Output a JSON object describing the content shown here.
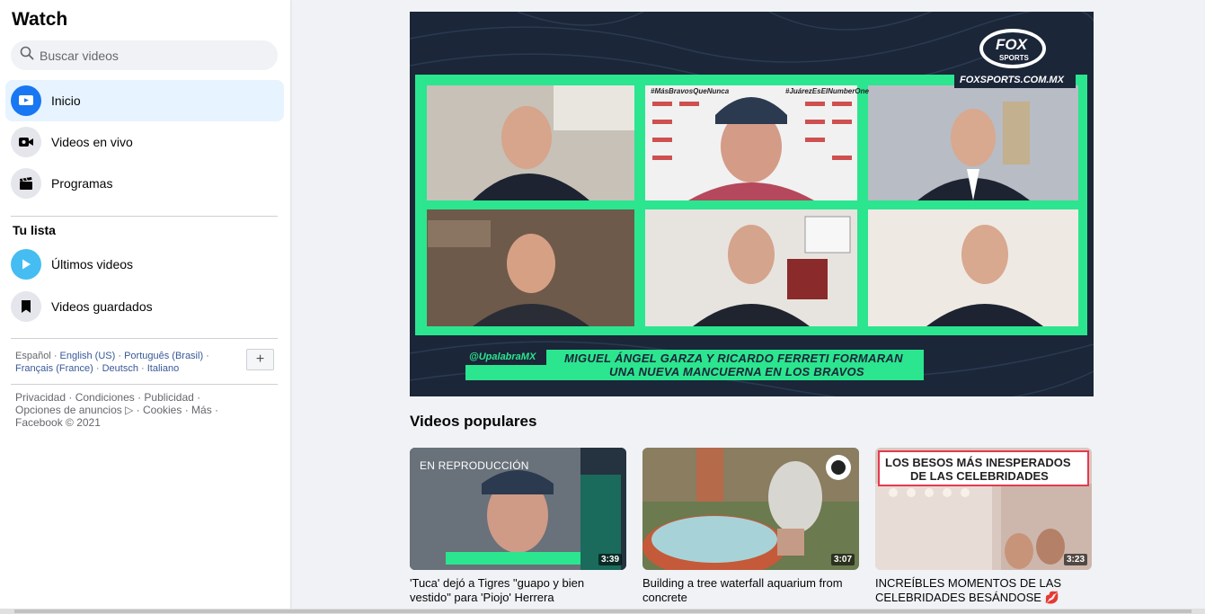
{
  "sidebar": {
    "title": "Watch",
    "search_placeholder": "Buscar videos",
    "items": [
      {
        "label": "Inicio",
        "icon": "video-screen-icon"
      },
      {
        "label": "Videos en vivo",
        "icon": "live-camera-icon"
      },
      {
        "label": "Programas",
        "icon": "clapperboard-icon"
      }
    ],
    "list_title": "Tu lista",
    "list_items": [
      {
        "label": "Últimos videos",
        "icon": "play-icon"
      },
      {
        "label": "Videos guardados",
        "icon": "bookmark-icon"
      }
    ],
    "languages": {
      "current": "Español",
      "others": [
        "English (US)",
        "Português (Brasil)",
        "Français (France)",
        "Deutsch",
        "Italiano"
      ],
      "more_label": "+"
    },
    "footer": {
      "privacy": "Privacidad",
      "terms": "Condiciones",
      "advertising": "Publicidad",
      "ad_choices": "Opciones de anuncios",
      "cookies": "Cookies",
      "more": "Más",
      "copyright": "Facebook © 2021"
    }
  },
  "video": {
    "brand": "FOXSPORTS.COM.MX",
    "logo_text_top": "FOX",
    "logo_text_bottom": "SPORTS",
    "handle": "@UpalabraMX",
    "headline_line1": "MIGUEL ÁNGEL GARZA Y RICARDO FERRETI FORMARAN",
    "headline_line2": "UNA NUEVA MANCUERNA EN LOS BRAVOS",
    "hashtag_left": "#MásBravosQueNunca",
    "hashtag_right": "#JuárezEsElNumberOne"
  },
  "popular": {
    "heading": "Videos populares",
    "cards": [
      {
        "title": "'Tuca' dejó a Tigres \"guapo y bien vestido\" para 'Piojo' Herrera",
        "duration": "3:39",
        "overlay": "EN REPRODUCCIÓN"
      },
      {
        "title": "Building a tree waterfall aquarium from concrete",
        "duration": "3:07"
      },
      {
        "title": "INCREÍBLES MOMENTOS DE LAS CELEBRIDADES BESÁNDOSE 💋",
        "duration": "3:23",
        "banner_line1": "LOS BESOS MÁS INESPERADOS",
        "banner_line2": "DE LAS CELEBRIDADES"
      }
    ]
  },
  "colors": {
    "accent": "#1877f2",
    "video_bg": "#1b2638",
    "video_green": "#2ce58f"
  }
}
